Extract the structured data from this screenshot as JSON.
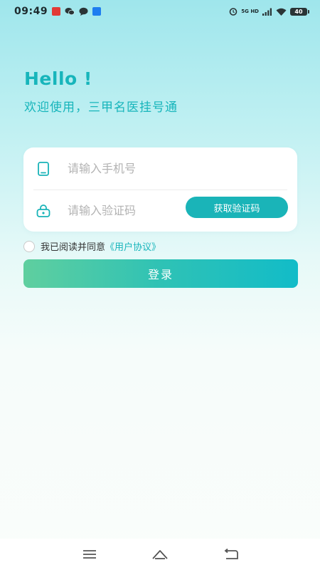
{
  "status_bar": {
    "time": "09:49",
    "network_top": "5G HD",
    "battery": "40"
  },
  "header": {
    "greeting": "Hello !",
    "welcome": "欢迎使用，三甲名医挂号通"
  },
  "form": {
    "phone_placeholder": "请输入手机号",
    "code_placeholder": "请输入验证码",
    "get_code_label": "获取验证码"
  },
  "agreement": {
    "text": "我已阅读并同意",
    "link": "《用户协议》",
    "checked": false
  },
  "login": {
    "label": "登录"
  },
  "icons": {
    "phone": "phone-icon",
    "lock": "lock-icon",
    "menu": "menu-icon",
    "home": "home-icon",
    "back": "back-icon"
  },
  "colors": {
    "accent": "#17b5bb",
    "button": "#1ab4b8",
    "gradient_start": "#5fcf9f",
    "gradient_end": "#12bcc8"
  }
}
